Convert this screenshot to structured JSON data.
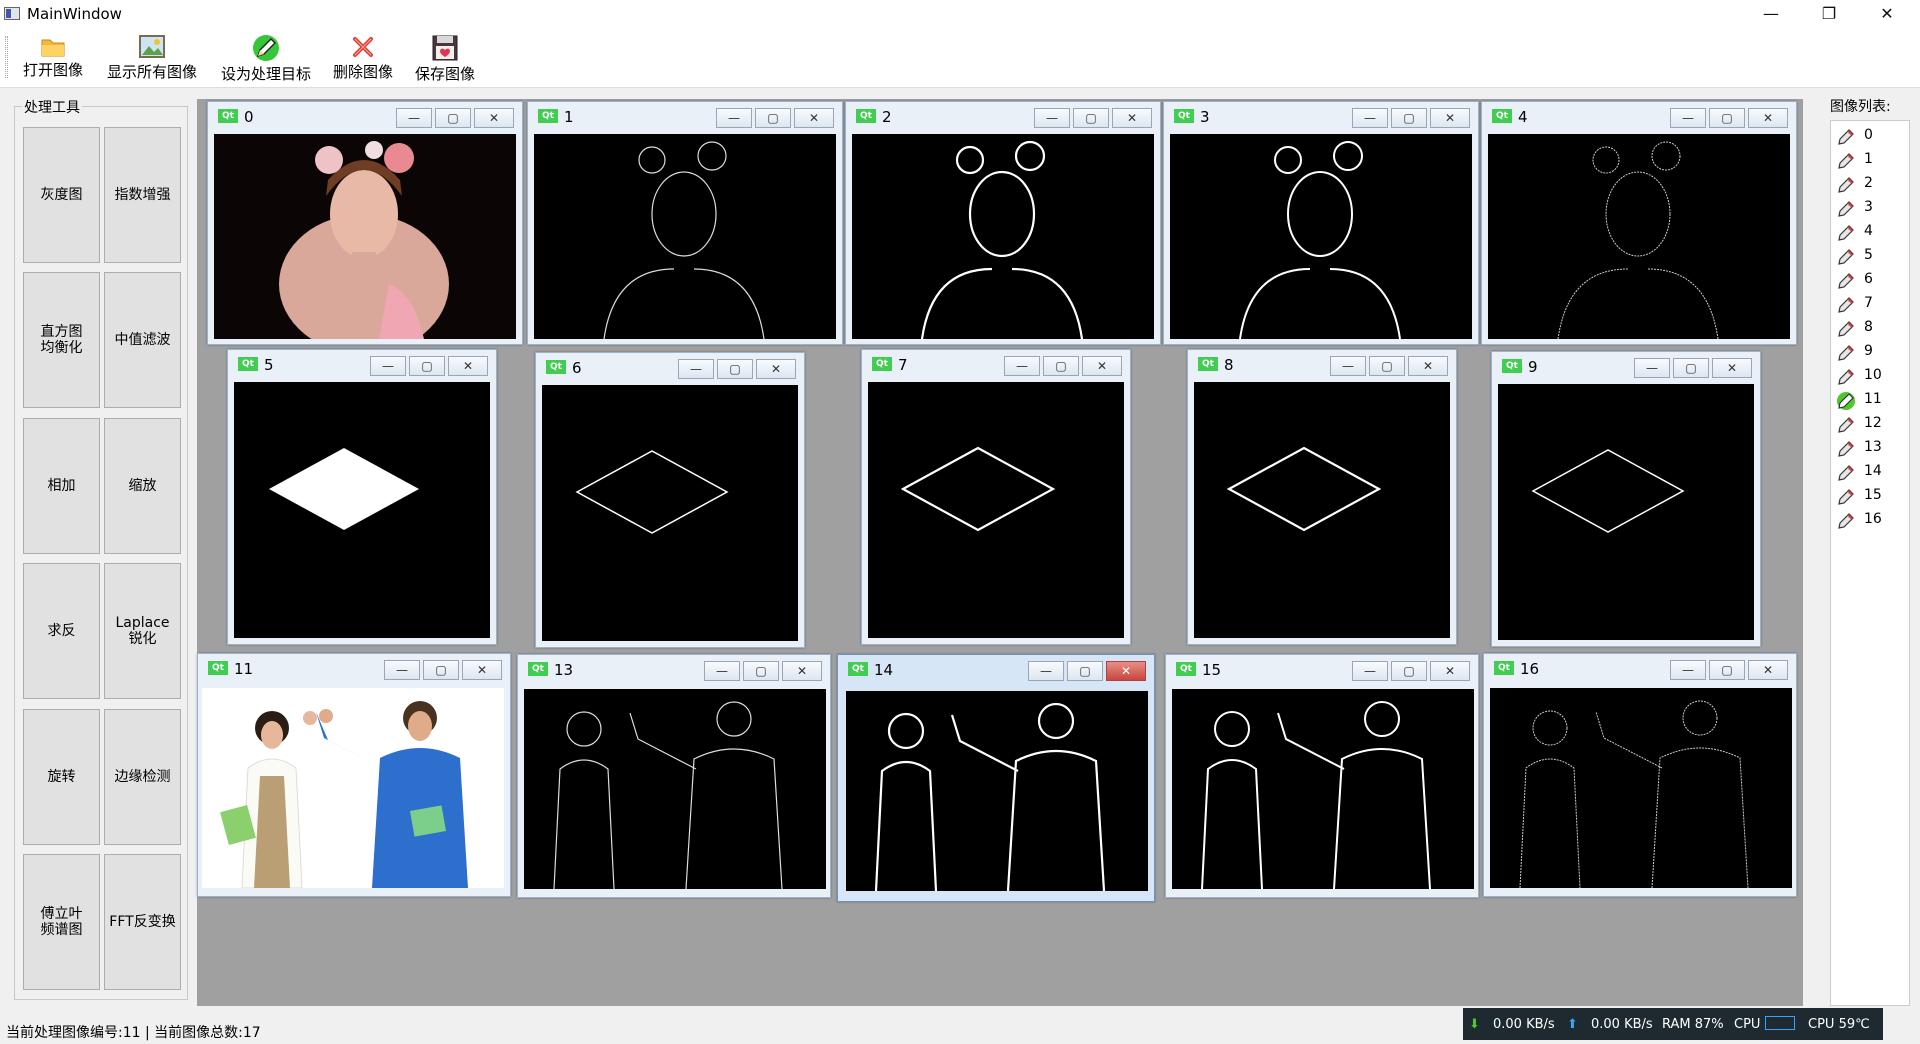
{
  "window": {
    "title": "MainWindow",
    "minimize": "—",
    "restore": "❐",
    "close": "✕"
  },
  "toolbar": {
    "open": "打开图像",
    "show_all": "显示所有图像",
    "set_target": "设为处理目标",
    "delete": "删除图像",
    "save": "保存图像"
  },
  "tools": {
    "title": "处理工具",
    "buttons": [
      "灰度图",
      "指数增强",
      "直方图\n均衡化",
      "中值滤波",
      "相加",
      "缩放",
      "求反",
      "Laplace\n锐化",
      "旋转",
      "边缘检测",
      "傅立叶\n频谱图",
      "FFT反变换"
    ]
  },
  "subwindows": [
    "0",
    "1",
    "2",
    "3",
    "4",
    "5",
    "6",
    "7",
    "8",
    "9",
    "11",
    "13",
    "14",
    "15",
    "16"
  ],
  "subwindow_buttons": {
    "min": "—",
    "max": "▢",
    "close": "✕"
  },
  "image_list": {
    "label": "图像列表:",
    "items": [
      "0",
      "1",
      "2",
      "3",
      "4",
      "5",
      "6",
      "7",
      "8",
      "9",
      "10",
      "11",
      "12",
      "13",
      "14",
      "15",
      "16"
    ],
    "selected": "11"
  },
  "status": {
    "text": "当前处理图像编号:11 | 当前图像总数:17"
  },
  "netmon": {
    "down": "0.00 KB/s",
    "up": "0.00 KB/s",
    "ram": "RAM 87%",
    "cpu": "CPU",
    "cpu_temp": "CPU 59℃"
  },
  "colors": {
    "mdi_bg": "#a0a0a0",
    "qt_badge": "#41cd52",
    "selected_icon": "#4fc82b"
  }
}
